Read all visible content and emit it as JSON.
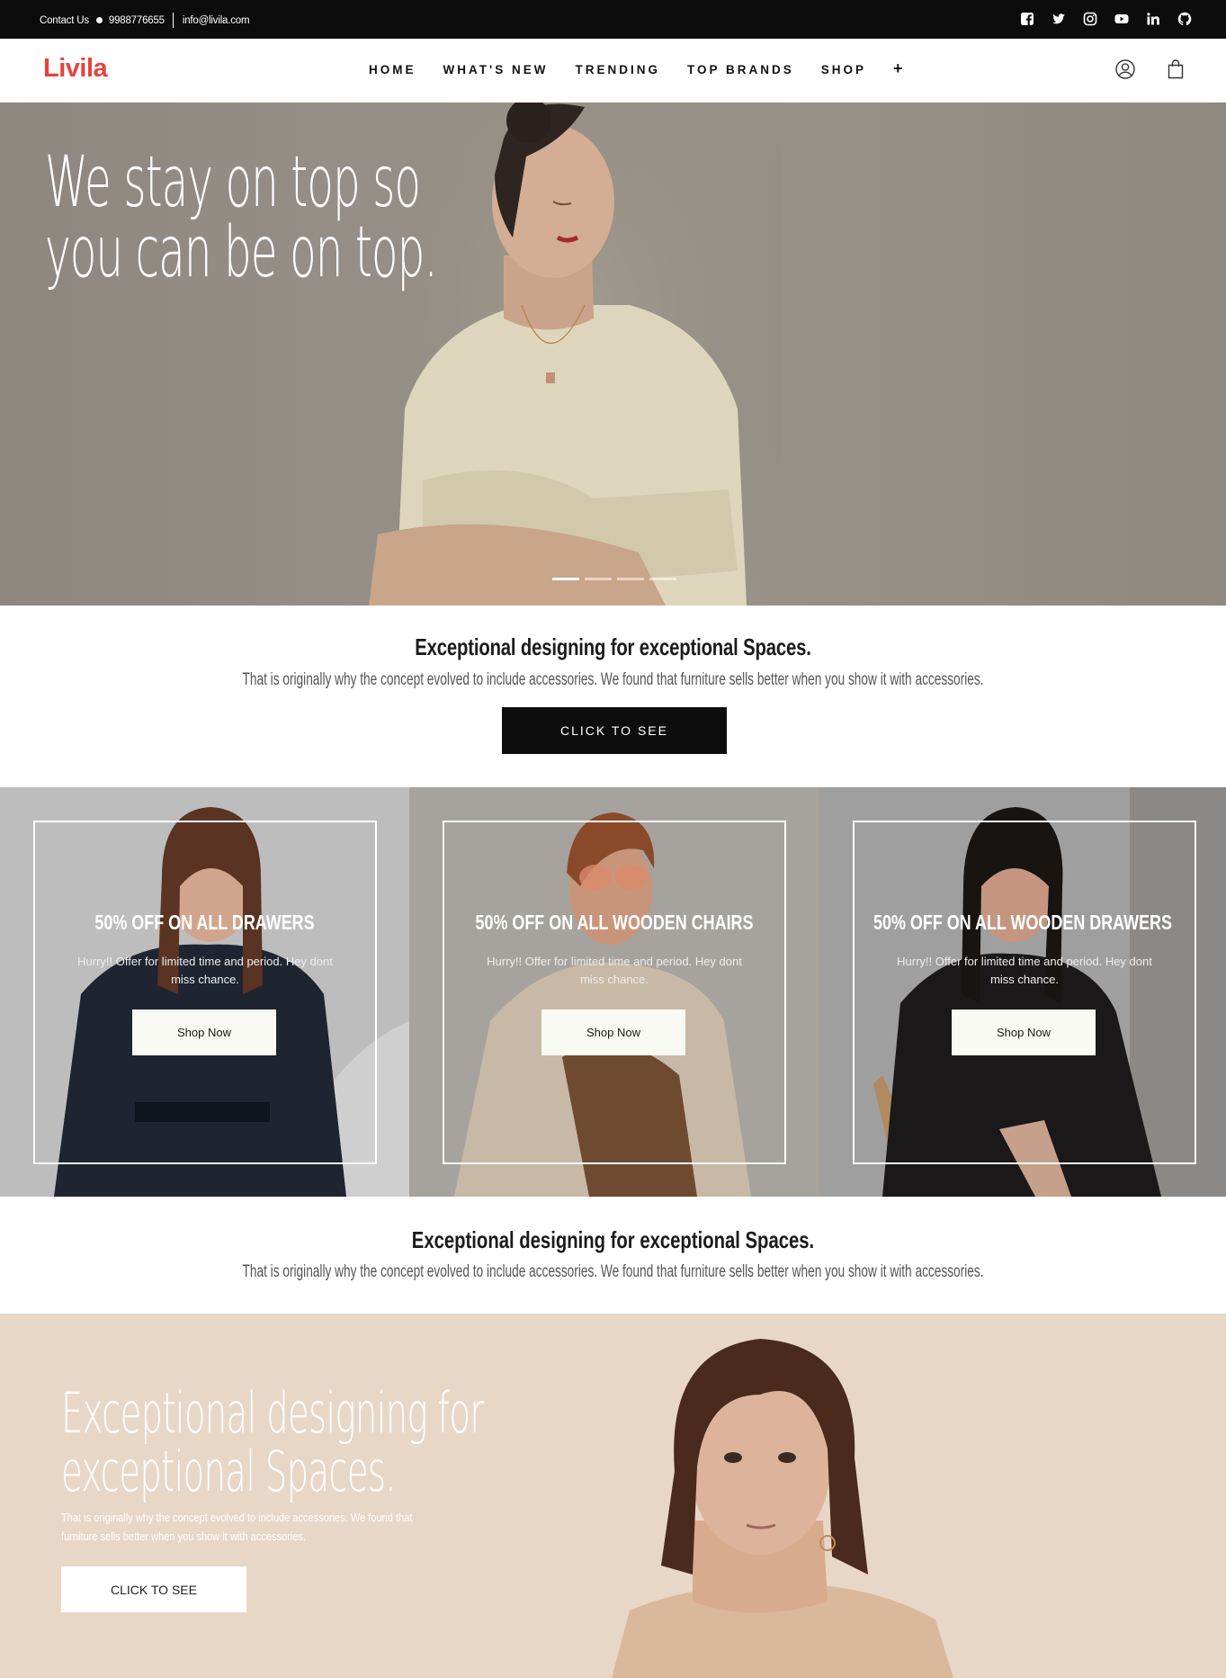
{
  "topbar": {
    "contact_label": "Contact Us",
    "phone": "9988776655",
    "email": "info@livila.com",
    "socials": [
      "facebook-icon",
      "twitter-icon",
      "instagram-icon",
      "youtube-icon",
      "linkedin-icon",
      "github-icon"
    ]
  },
  "header": {
    "logo": "Livila",
    "nav": [
      "HOME",
      "WHAT'S NEW",
      "TRENDING",
      "TOP BRANDS",
      "SHOP",
      "+"
    ],
    "icons": [
      "user-icon",
      "bag-icon"
    ]
  },
  "hero": {
    "title_line1": "We stay on top so",
    "title_line2": "you can be on top.",
    "slides": 4,
    "active_slide": 1
  },
  "intro": {
    "heading": "Exceptional designing for exceptional Spaces.",
    "text": "That is originally why the concept evolved to include accessories. We found that furniture sells better when you show it with accessories.",
    "button": "CLICK TO SEE"
  },
  "promos": [
    {
      "title": "50% OFF ON ALL DRAWERS",
      "desc": "Hurry!! Offer for limited time and period. Hey dont miss chance.",
      "button": "Shop Now"
    },
    {
      "title": "50% OFF ON ALL WOODEN CHAIRS",
      "desc": "Hurry!! Offer for limited time and period. Hey dont miss chance.",
      "button": "Shop Now"
    },
    {
      "title": "50% OFF ON ALL WOODEN DRAWERS",
      "desc": "Hurry!! Offer for limited time and period. Hey dont miss chance.",
      "button": "Shop Now"
    }
  ],
  "intro2": {
    "heading": "Exceptional designing for exceptional Spaces.",
    "text": "That is originally why the concept evolved to include accessories. We found that furniture sells better when you show it with accessories."
  },
  "feature": {
    "title_line1": "Exceptional designing for",
    "title_line2": "exceptional Spaces.",
    "text": "That is originally why the concept evolved to include accessories. We found that furniture sells better when you show it with accessories.",
    "button": "CLICK TO SEE"
  },
  "colors": {
    "brand": "#e8423a",
    "topbar": "#0c0c0c",
    "dark_button": "#0d0d0d",
    "feature_bg": "#e8d7c7"
  }
}
